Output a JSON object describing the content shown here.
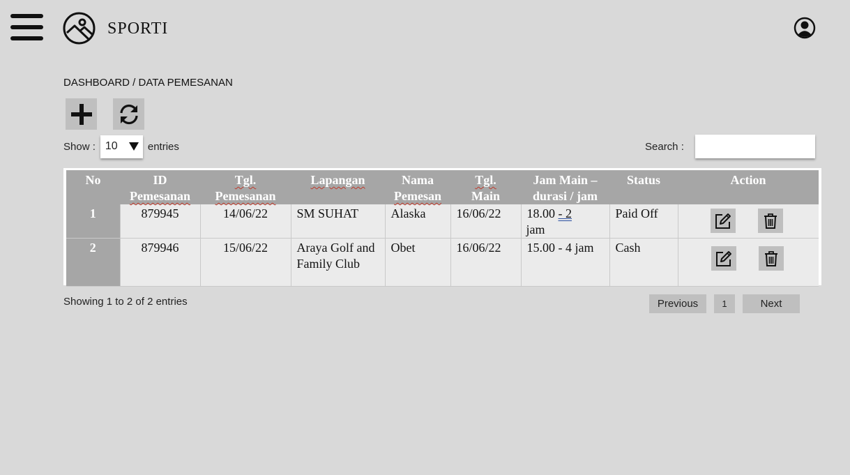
{
  "header": {
    "brand": "SPORTI",
    "menu_icon": "hamburger-menu-icon",
    "logo_icon": "image-logo-icon",
    "user_icon": "user-circle-icon"
  },
  "breadcrumb": "DASHBOARD / DATA PEMESANAN",
  "toolbar": {
    "add_icon": "plus-icon",
    "refresh_icon": "refresh-icon"
  },
  "length_control": {
    "show_label": "Show :",
    "value": "10",
    "entries_label": "entries"
  },
  "search": {
    "label": "Search :",
    "value": ""
  },
  "table": {
    "columns": {
      "no": "No",
      "id_1": "ID",
      "id_2": "Pemesanan",
      "tgl_pem_1": "Tgl.",
      "tgl_pem_2": "Pemesanan",
      "lapangan": "Lapangan",
      "nama_1": "Nama",
      "nama_2": "Pemesan",
      "tgl_main_1": "Tgl.",
      "tgl_main_2": "Main",
      "jam_1": "Jam Main –",
      "jam_2": "durasi / jam",
      "status": "Status",
      "action": "Action"
    },
    "rows": [
      {
        "no": "1",
        "id": "879945",
        "tgl_pemesanan": "14/06/22",
        "lapangan": "SM SUHAT",
        "nama": "Alaska",
        "tgl_main": "16/06/22",
        "jam_a": "18.00",
        "jam_b": "- 2",
        "jam_c": "jam",
        "status": "Paid Off"
      },
      {
        "no": "2",
        "id": "879946",
        "tgl_pemesanan": "15/06/22",
        "lapangan": "Araya Golf and Family Club",
        "nama": "Obet",
        "tgl_main": "16/06/22",
        "jam": "15.00 - 4 jam",
        "status": "Cash"
      }
    ],
    "action_icons": [
      "edit-icon",
      "trash-icon"
    ]
  },
  "footer": {
    "showing": "Showing 1 to 2 of 2 entries",
    "previous": "Previous",
    "page": "1",
    "next": "Next"
  }
}
